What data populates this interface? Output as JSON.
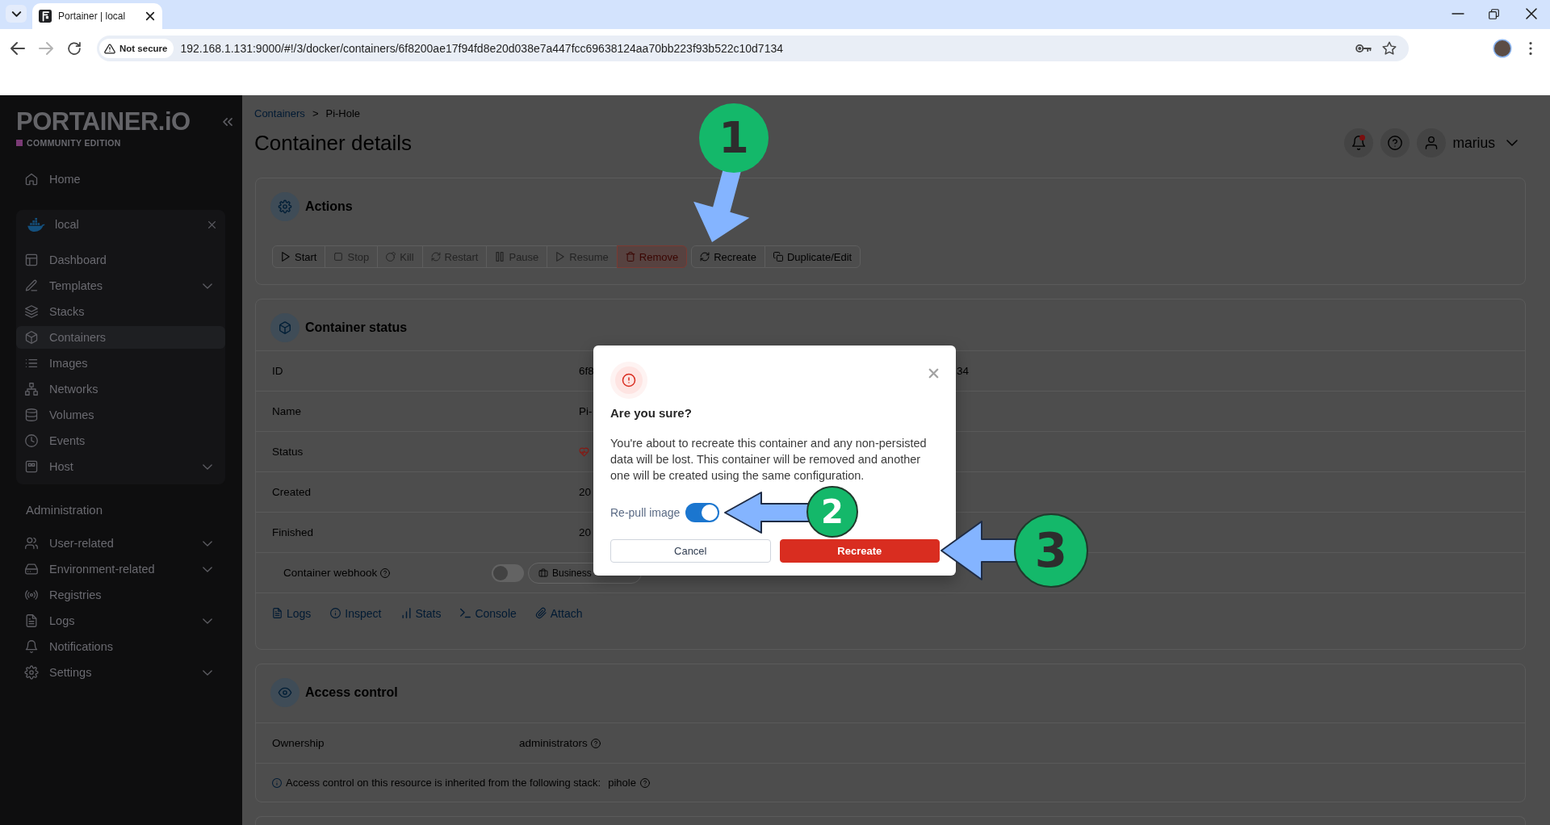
{
  "browser": {
    "tab": {
      "title": "Portainer | local"
    },
    "forward_disabled": true,
    "security_label": "Not secure",
    "url": "192.168.1.131:9000/#!/3/docker/containers/6f8200ae17f94fd8e20d038e7a447fcc69638124aa70bb223f93b522c10d7134"
  },
  "sidebar": {
    "logo": "PORTAINER.iO",
    "edition": "COMMUNITY EDITION",
    "home": {
      "label": "Home",
      "selected": false,
      "expandable": false
    },
    "environment": {
      "name": "local",
      "items": [
        {
          "label": "Dashboard",
          "selected": false,
          "expandable": false
        },
        {
          "label": "Templates",
          "selected": false,
          "expandable": true
        },
        {
          "label": "Stacks",
          "selected": false,
          "expandable": false
        },
        {
          "label": "Containers",
          "selected": true,
          "expandable": false
        },
        {
          "label": "Images",
          "selected": false,
          "expandable": false
        },
        {
          "label": "Networks",
          "selected": false,
          "expandable": false
        },
        {
          "label": "Volumes",
          "selected": false,
          "expandable": false
        },
        {
          "label": "Events",
          "selected": false,
          "expandable": false
        },
        {
          "label": "Host",
          "selected": false,
          "expandable": true
        }
      ]
    },
    "admin_heading": "Administration",
    "admin_items": [
      {
        "label": "User-related",
        "selected": false,
        "expandable": true
      },
      {
        "label": "Environment-related",
        "selected": false,
        "expandable": true
      },
      {
        "label": "Registries",
        "selected": false,
        "expandable": false
      },
      {
        "label": "Logs",
        "selected": false,
        "expandable": true
      },
      {
        "label": "Notifications",
        "selected": false,
        "expandable": false
      },
      {
        "label": "Settings",
        "selected": false,
        "expandable": true
      }
    ]
  },
  "header": {
    "breadcrumb": {
      "items": [
        "Containers",
        "Pi-Hole"
      ],
      "separator": ">"
    },
    "title": "Container details",
    "notifications_unread": true,
    "user": "marius"
  },
  "actions": {
    "title": "Actions",
    "groups": [
      {
        "buttons": [
          {
            "label": "Start",
            "disabled": false,
            "kind": "default"
          },
          {
            "label": "Stop",
            "disabled": true,
            "kind": "default"
          },
          {
            "label": "Kill",
            "disabled": true,
            "kind": "default"
          },
          {
            "label": "Restart",
            "disabled": true,
            "kind": "default"
          },
          {
            "label": "Pause",
            "disabled": true,
            "kind": "default"
          },
          {
            "label": "Resume",
            "disabled": true,
            "kind": "default"
          },
          {
            "label": "Remove",
            "disabled": false,
            "kind": "danger"
          }
        ]
      },
      {
        "buttons": [
          {
            "label": "Recreate",
            "disabled": false,
            "kind": "default"
          },
          {
            "label": "Duplicate/Edit",
            "disabled": false,
            "kind": "default"
          }
        ]
      }
    ]
  },
  "container_status": {
    "title": "Container status",
    "rows": [
      {
        "kind": "text",
        "label": "ID",
        "value": "6f8",
        "value_end": "34"
      },
      {
        "kind": "text",
        "label": "Name",
        "value": "Pi-"
      },
      {
        "kind": "status",
        "label": "Status"
      },
      {
        "kind": "text",
        "label": "Created",
        "value": "20"
      },
      {
        "kind": "text",
        "label": "Finished",
        "value": "20"
      },
      {
        "kind": "webhook",
        "label": "Container webhook",
        "on": false,
        "feature": "Business"
      }
    ],
    "links": [
      "Logs",
      "Inspect",
      "Stats",
      "Console",
      "Attach"
    ]
  },
  "access_control": {
    "title": "Access control",
    "rows": [
      {
        "label": "Ownership",
        "value": "administrators"
      }
    ],
    "note": {
      "text": "Access control on this resource is inherited from the following stack:",
      "stack": "pihole"
    }
  },
  "modal": {
    "title": "Are you sure?",
    "message": "You're about to recreate this container and any non-persisted data will be lost. This container will be removed and another one will be created using the same configuration.",
    "option": {
      "label": "Re-pull image",
      "on": true
    },
    "buttons": [
      {
        "label": "Cancel",
        "kind": "secondary"
      },
      {
        "label": "Recreate",
        "kind": "danger"
      }
    ]
  },
  "callouts": [
    {
      "number": "1"
    },
    {
      "number": "2"
    },
    {
      "number": "3"
    }
  ]
}
